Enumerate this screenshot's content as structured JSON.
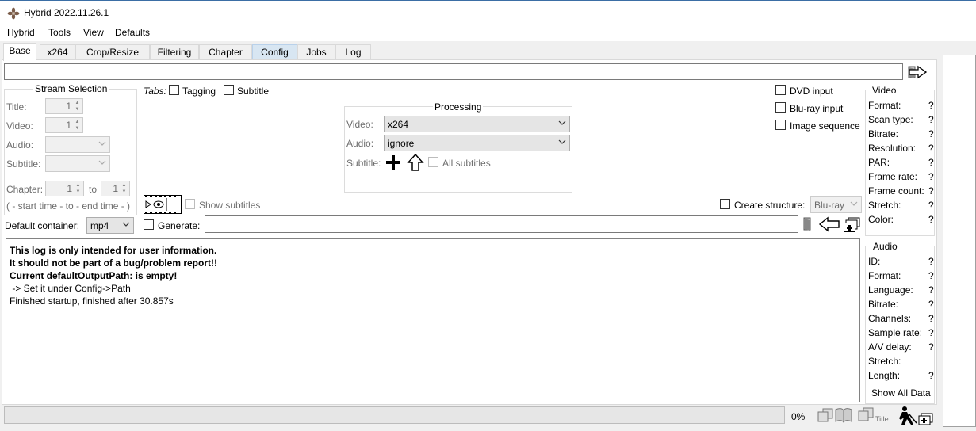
{
  "window": {
    "title": "Hybrid 2022.11.26.1"
  },
  "menu": {
    "items": [
      "Hybrid",
      "Tools",
      "View",
      "Defaults"
    ]
  },
  "tabs": [
    "Base",
    "x264",
    "Crop/Resize",
    "Filtering",
    "Chapter",
    "Config",
    "Jobs",
    "Log"
  ],
  "stream_selection": {
    "legend": "Stream Selection",
    "title_label": "Title:",
    "title_value": "1",
    "video_label": "Video:",
    "video_value": "1",
    "audio_label": "Audio:",
    "subtitle_label": "Subtitle:",
    "chapter_label": "Chapter:",
    "chapter_from": "1",
    "to_label": "to",
    "chapter_to": "1",
    "time_hint": "( - start time - to - end time - )"
  },
  "tabs_opts": {
    "label": "Tabs:",
    "tagging": "Tagging",
    "subtitle": "Subtitle"
  },
  "processing": {
    "legend": "Processing",
    "video_label": "Video:",
    "video_value": "x264",
    "audio_label": "Audio:",
    "audio_value": "ignore",
    "subtitle_label": "Subtitle:",
    "all_subtitles": "All subtitles"
  },
  "input_options": {
    "dvd": "DVD input",
    "bluray": "Blu-ray input",
    "image_seq": "Image sequence"
  },
  "preview": {
    "show_subtitles": "Show subtitles"
  },
  "structure": {
    "label": "Create structure:",
    "value": "Blu-ray"
  },
  "output": {
    "container_label": "Default container:",
    "container_value": "mp4",
    "generate_label": "Generate:"
  },
  "log": {
    "lines": [
      "This log is only intended for user information.",
      "It should not be part of a bug/problem report!!",
      "Current defaultOutputPath: is empty!",
      " -> Set it under Config->Path",
      "Finished startup, finished after 30.857s"
    ]
  },
  "video_info": {
    "legend": "Video",
    "rows": [
      {
        "label": "Format:",
        "value": "?"
      },
      {
        "label": "Scan type:",
        "value": "?"
      },
      {
        "label": "Bitrate:",
        "value": "?"
      },
      {
        "label": "Resolution:",
        "value": "?"
      },
      {
        "label": "PAR:",
        "value": "?"
      },
      {
        "label": "Frame rate:",
        "value": "?"
      },
      {
        "label": "Frame count:",
        "value": "?"
      },
      {
        "label": "Stretch:",
        "value": "?"
      },
      {
        "label": "Color:",
        "value": "?"
      }
    ]
  },
  "audio_info": {
    "legend": "Audio",
    "rows": [
      {
        "label": "ID:",
        "value": "?"
      },
      {
        "label": "Format:",
        "value": "?"
      },
      {
        "label": "Language:",
        "value": "?"
      },
      {
        "label": "Bitrate:",
        "value": "?"
      },
      {
        "label": "Channels:",
        "value": "?"
      },
      {
        "label": "Sample rate:",
        "value": "?"
      },
      {
        "label": "A/V delay:",
        "value": "?"
      },
      {
        "label": "Stretch:",
        "value": ""
      },
      {
        "label": "Length:",
        "value": "?"
      }
    ],
    "show_all": "Show All Data"
  },
  "status": {
    "progress_text": "0%",
    "progress": 0,
    "title_icon_label": "Title"
  },
  "colors": {
    "accent": "#3b6ea5",
    "tab_hover": "#d8e6f2",
    "panel_bg": "#ffffff",
    "window_bg": "#f0f0f0"
  }
}
